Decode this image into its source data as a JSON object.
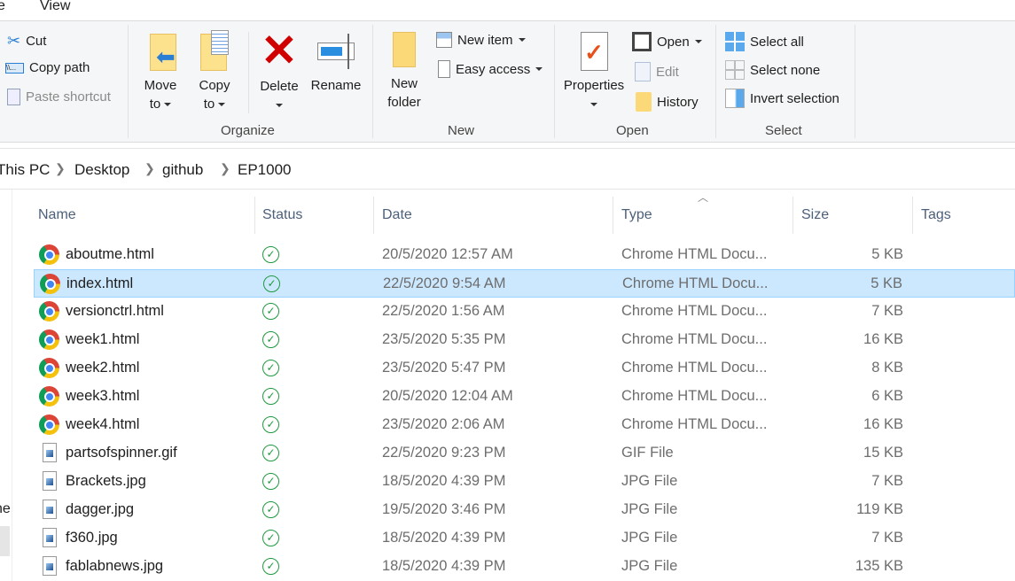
{
  "tabs": {
    "partial_left": "e",
    "view": "View"
  },
  "ribbon": {
    "clipboard": {
      "cut": "Cut",
      "copy_path": "Copy path",
      "paste_shortcut": "Paste shortcut"
    },
    "organize": {
      "label": "Organize",
      "move_to": [
        "Move",
        "to"
      ],
      "copy_to": [
        "Copy",
        "to"
      ],
      "delete": "Delete",
      "rename": "Rename"
    },
    "new": {
      "label": "New",
      "new_folder": [
        "New",
        "folder"
      ],
      "new_item": "New item",
      "easy_access": "Easy access"
    },
    "open": {
      "label": "Open",
      "properties": "Properties",
      "open": "Open",
      "edit": "Edit",
      "history": "History"
    },
    "select": {
      "label": "Select",
      "select_all": "Select all",
      "select_none": "Select none",
      "invert": "Invert selection"
    }
  },
  "breadcrumb": [
    "This PC",
    "Desktop",
    "github",
    "EP1000"
  ],
  "nav": {
    "partial_label": "ne"
  },
  "columns": {
    "name": "Name",
    "status": "Status",
    "date": "Date",
    "type": "Type",
    "size": "Size",
    "tags": "Tags"
  },
  "colors": {
    "selected_bg": "#cce8ff",
    "selected_border": "#99d1ff",
    "status_ok": "#1e9a3c"
  },
  "files": [
    {
      "name": "aboutme.html",
      "icon": "chrome-icon",
      "date": "20/5/2020 12:57 AM",
      "type": "Chrome HTML Docu...",
      "size": "5 KB"
    },
    {
      "name": "index.html",
      "icon": "chrome-icon",
      "date": "22/5/2020 9:54 AM",
      "type": "Chrome HTML Docu...",
      "size": "5 KB",
      "selected": true
    },
    {
      "name": "versionctrl.html",
      "icon": "chrome-icon",
      "date": "22/5/2020 1:56 AM",
      "type": "Chrome HTML Docu...",
      "size": "7 KB"
    },
    {
      "name": "week1.html",
      "icon": "chrome-icon",
      "date": "23/5/2020 5:35 PM",
      "type": "Chrome HTML Docu...",
      "size": "16 KB"
    },
    {
      "name": "week2.html",
      "icon": "chrome-icon",
      "date": "23/5/2020 5:47 PM",
      "type": "Chrome HTML Docu...",
      "size": "8 KB"
    },
    {
      "name": "week3.html",
      "icon": "chrome-icon",
      "date": "20/5/2020 12:04 AM",
      "type": "Chrome HTML Docu...",
      "size": "6 KB"
    },
    {
      "name": "week4.html",
      "icon": "chrome-icon",
      "date": "23/5/2020 2:06 AM",
      "type": "Chrome HTML Docu...",
      "size": "16 KB"
    },
    {
      "name": "partsofspinner.gif",
      "icon": "image-file-icon",
      "date": "22/5/2020 9:23 PM",
      "type": "GIF File",
      "size": "15 KB"
    },
    {
      "name": "Brackets.jpg",
      "icon": "image-file-icon",
      "date": "18/5/2020 4:39 PM",
      "type": "JPG File",
      "size": "7 KB"
    },
    {
      "name": "dagger.jpg",
      "icon": "image-file-icon",
      "date": "19/5/2020 3:46 PM",
      "type": "JPG File",
      "size": "119 KB"
    },
    {
      "name": "f360.jpg",
      "icon": "image-file-icon",
      "date": "18/5/2020 4:39 PM",
      "type": "JPG File",
      "size": "7 KB"
    },
    {
      "name": "fablabnews.jpg",
      "icon": "image-file-icon",
      "date": "18/5/2020 4:39 PM",
      "type": "JPG File",
      "size": "135 KB"
    }
  ]
}
